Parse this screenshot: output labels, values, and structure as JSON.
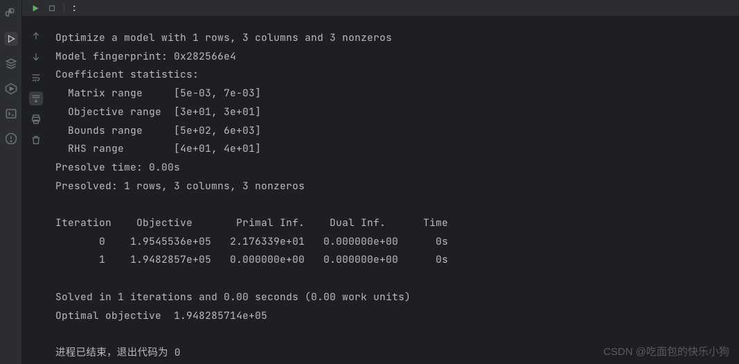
{
  "topbar": {
    "path_indicator": ":"
  },
  "console": {
    "lines": [
      "Optimize a model with 1 rows, 3 columns and 3 nonzeros",
      "Model fingerprint: 0x282566e4",
      "Coefficient statistics:",
      "  Matrix range     [5e-03, 7e-03]",
      "  Objective range  [3e+01, 3e+01]",
      "  Bounds range     [5e+02, 6e+03]",
      "  RHS range        [4e+01, 4e+01]",
      "Presolve time: 0.00s",
      "Presolved: 1 rows, 3 columns, 3 nonzeros",
      "",
      "Iteration    Objective       Primal Inf.    Dual Inf.      Time",
      "       0    1.9545536e+05   2.176339e+01   0.000000e+00      0s",
      "       1    1.9482857e+05   0.000000e+00   0.000000e+00      0s",
      "",
      "Solved in 1 iterations and 0.00 seconds (0.00 work units)",
      "Optimal objective  1.948285714e+05",
      "",
      "进程已结束，退出代码为 0"
    ]
  },
  "watermark": "CSDN @吃面包的快乐小狗",
  "icons": {
    "python": "python-icon",
    "play": "play-icon",
    "debug": "debug-icon",
    "terminal": "terminal-icon",
    "problems": "problems-icon",
    "services": "services-icon",
    "up": "arrow-up-icon",
    "down": "arrow-down-icon",
    "wrap": "wrap-icon",
    "scroll": "scroll-to-end-icon",
    "print": "print-icon",
    "trash": "trash-icon"
  }
}
